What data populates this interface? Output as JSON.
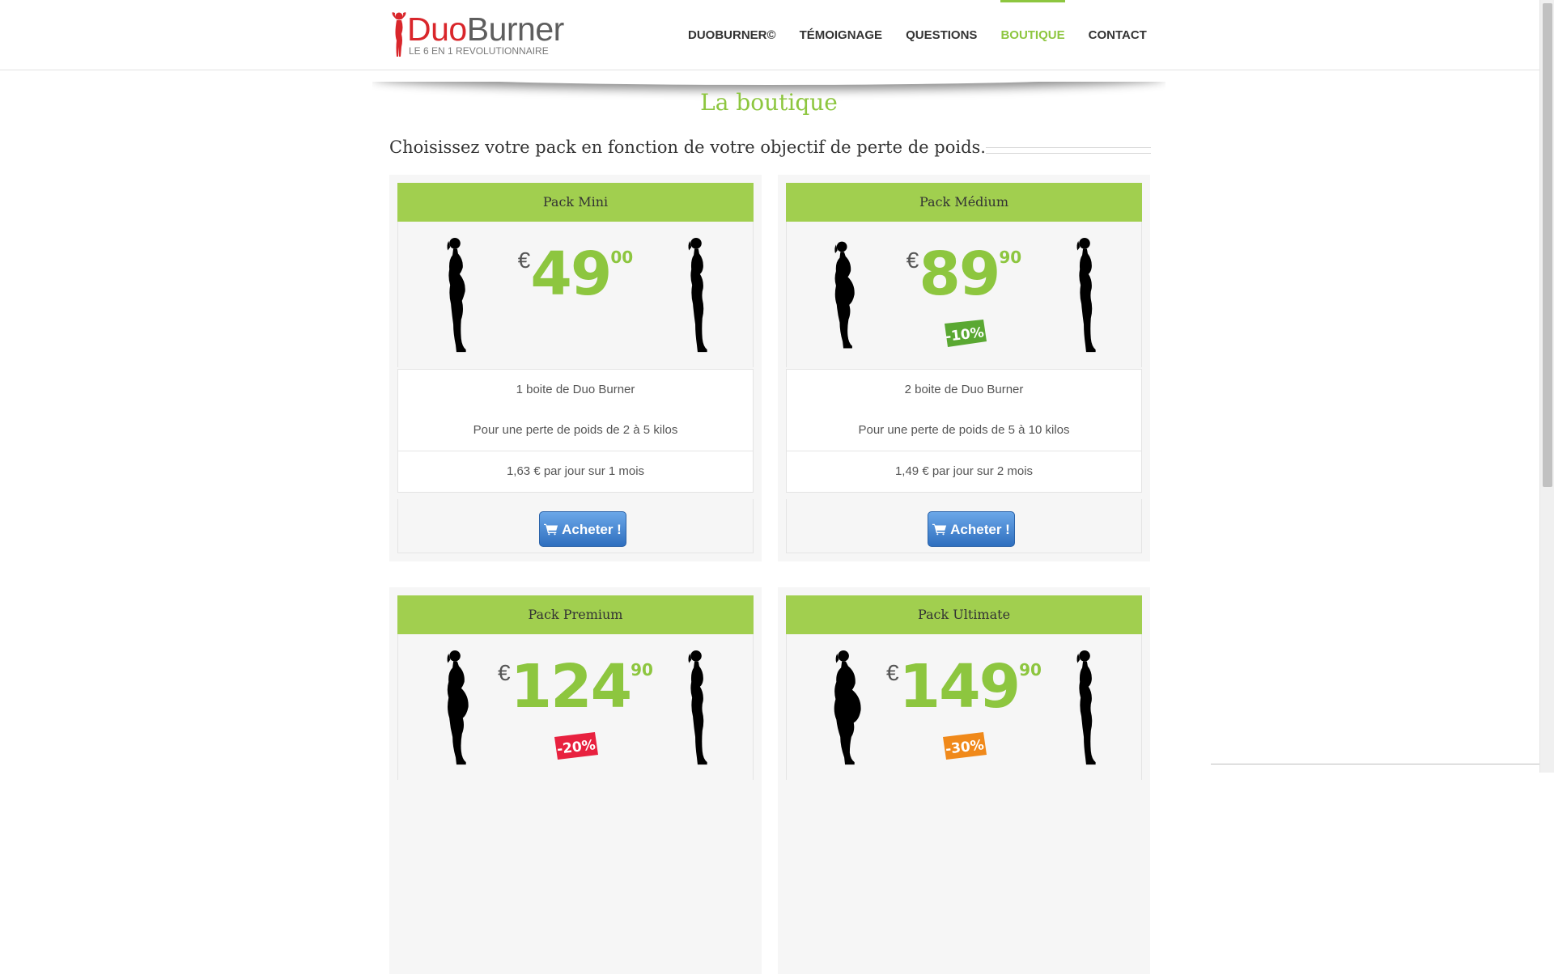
{
  "header": {
    "logo_main": "Duo",
    "logo_secondary": "Burner",
    "logo_tagline": "LE 6 EN 1 REVOLUTIONNAIRE",
    "nav": [
      {
        "label": "DUOBURNER©",
        "active": false
      },
      {
        "label": "TÉMOIGNAGE",
        "active": false
      },
      {
        "label": "QUESTIONS",
        "active": false
      },
      {
        "label": "BOUTIQUE",
        "active": true
      },
      {
        "label": "CONTACT",
        "active": false
      }
    ]
  },
  "page": {
    "title": "La boutique",
    "subtitle": "Choisissez votre pack en fonction de votre objectif de perte de poids."
  },
  "colors": {
    "accent": "#8dc63f",
    "header_bar": "#a1cf4f",
    "button": "#3a7bd5",
    "badge_10": "#5aa832",
    "badge_20": "#e8213f",
    "badge_30": "#f0891a"
  },
  "packs": [
    {
      "name": "Pack Mini",
      "currency": "€",
      "price_int": "49",
      "price_dec": "00",
      "discount": "",
      "features": [
        "1 boite de Duo Burner",
        "Pour une perte de poids de 2 à 5 kilos",
        "1,63 € par jour sur 1 mois"
      ],
      "button_label": "Acheter !",
      "button_icon": "shopping-cart-icon"
    },
    {
      "name": "Pack Médium",
      "currency": "€",
      "price_int": "89",
      "price_dec": "90",
      "discount": "-10%",
      "features": [
        "2 boite de Duo Burner",
        "Pour une perte de poids de 5 à 10 kilos",
        "1,49 € par jour sur 2 mois"
      ],
      "button_label": "Acheter !",
      "button_icon": "shopping-cart-icon"
    },
    {
      "name": "Pack Premium",
      "currency": "€",
      "price_int": "124",
      "price_dec": "90",
      "discount": "-20%"
    },
    {
      "name": "Pack Ultimate",
      "currency": "€",
      "price_int": "149",
      "price_dec": "90",
      "discount": "-30%"
    }
  ]
}
